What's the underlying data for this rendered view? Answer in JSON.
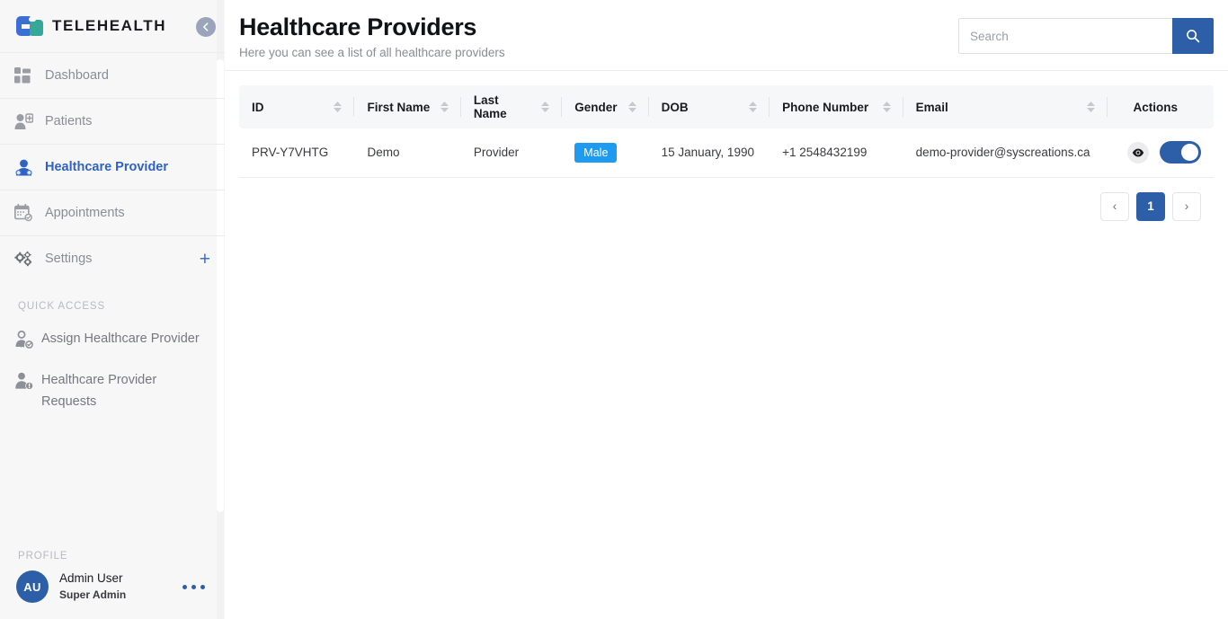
{
  "sidebar": {
    "brand": {
      "name": "TELEHEALTH",
      "logo_icon": "telehealth-logo-icon"
    },
    "collapse_label": "Collapse sidebar",
    "nav": [
      {
        "label": "Dashboard",
        "icon": "dashboard-grid-icon",
        "active": false
      },
      {
        "label": "Patients",
        "icon": "patients-icon",
        "active": false
      },
      {
        "label": "Healthcare Provider",
        "icon": "healthcare-provider-icon",
        "active": true
      },
      {
        "label": "Appointments",
        "icon": "calendar-check-icon",
        "active": false
      },
      {
        "label": "Settings",
        "icon": "gears-icon",
        "active": false,
        "plus": "+"
      }
    ],
    "quick_access": {
      "title": "QUICK ACCESS",
      "items": [
        {
          "label": "Assign Healthcare Provider",
          "icon": "assign-provider-icon"
        },
        {
          "label": "Healthcare Provider Requests",
          "icon": "provider-requests-icon"
        }
      ]
    },
    "profile": {
      "title": "PROFILE",
      "initials": "AU",
      "name": "Admin User",
      "role": "Super Admin",
      "menu_icon": "three-dots-icon"
    }
  },
  "header": {
    "title": "Healthcare Providers",
    "subtitle": "Here you can see a list of all healthcare providers"
  },
  "search": {
    "placeholder": "Search",
    "value": "",
    "button_icon": "search-icon"
  },
  "table": {
    "columns": [
      {
        "label": "ID",
        "sortable": true
      },
      {
        "label": "First Name",
        "sortable": true
      },
      {
        "label": "Last Name",
        "sortable": true
      },
      {
        "label": "Gender",
        "sortable": true
      },
      {
        "label": "DOB",
        "sortable": true
      },
      {
        "label": "Phone Number",
        "sortable": true
      },
      {
        "label": "Email",
        "sortable": true
      },
      {
        "label": "Actions",
        "sortable": false
      }
    ],
    "rows": [
      {
        "id": "PRV-Y7VHTG",
        "first_name": "Demo",
        "last_name": "Provider",
        "gender": "Male",
        "dob": "15 January, 1990",
        "phone": "+1 2548432199",
        "email": "demo-provider@syscreations.ca",
        "view_icon": "eye-icon",
        "toggle_on": true
      }
    ]
  },
  "pagination": {
    "prev": "‹",
    "pages": [
      "1"
    ],
    "next": "›",
    "current": "1"
  },
  "colors": {
    "primary": "#2c5fa8",
    "accent_blue": "#3b6fd4",
    "badge_blue": "#1e9bf0",
    "teal": "#35a898",
    "sidebar_bg": "#f7f7f8",
    "muted_text": "#8a8d95"
  }
}
